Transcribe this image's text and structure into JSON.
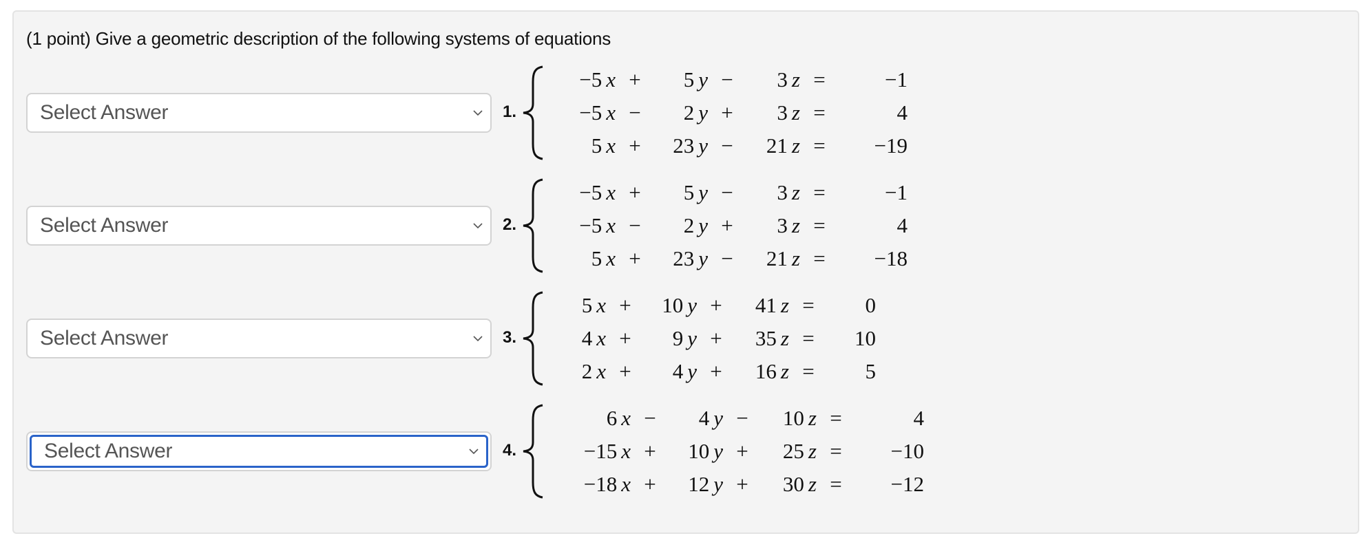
{
  "prompt": "(1 point) Give a geometric description of the following systems of equations",
  "select_placeholder": "Select Answer",
  "systems": [
    {
      "label": "1.",
      "focused": false,
      "rows": [
        {
          "a": "−5",
          "op1": "+",
          "b": "5",
          "op2": "−",
          "c": "3",
          "rhs": "−1"
        },
        {
          "a": "−5",
          "op1": "−",
          "b": "2",
          "op2": "+",
          "c": "3",
          "rhs": "4"
        },
        {
          "a": "5",
          "op1": "+",
          "b": "23",
          "op2": "−",
          "c": "21",
          "rhs": "−19"
        }
      ]
    },
    {
      "label": "2.",
      "focused": false,
      "rows": [
        {
          "a": "−5",
          "op1": "+",
          "b": "5",
          "op2": "−",
          "c": "3",
          "rhs": "−1"
        },
        {
          "a": "−5",
          "op1": "−",
          "b": "2",
          "op2": "+",
          "c": "3",
          "rhs": "4"
        },
        {
          "a": "5",
          "op1": "+",
          "b": "23",
          "op2": "−",
          "c": "21",
          "rhs": "−18"
        }
      ]
    },
    {
      "label": "3.",
      "focused": false,
      "rows": [
        {
          "a": "5",
          "op1": "+",
          "b": "10",
          "op2": "+",
          "c": "41",
          "rhs": "0"
        },
        {
          "a": "4",
          "op1": "+",
          "b": "9",
          "op2": "+",
          "c": "35",
          "rhs": "10"
        },
        {
          "a": "2",
          "op1": "+",
          "b": "4",
          "op2": "+",
          "c": "16",
          "rhs": "5"
        }
      ]
    },
    {
      "label": "4.",
      "focused": true,
      "rows": [
        {
          "a": "6",
          "op1": "−",
          "b": "4",
          "op2": "−",
          "c": "10",
          "rhs": "4"
        },
        {
          "a": "−15",
          "op1": "+",
          "b": "10",
          "op2": "+",
          "c": "25",
          "rhs": "−10"
        },
        {
          "a": "−18",
          "op1": "+",
          "b": "12",
          "op2": "+",
          "c": "30",
          "rhs": "−12"
        }
      ]
    }
  ],
  "variables": {
    "x": "x",
    "y": "y",
    "z": "z",
    "equals": "="
  },
  "colors": {
    "focus_ring": "#2a63c9",
    "panel_bg": "#f4f4f4"
  }
}
